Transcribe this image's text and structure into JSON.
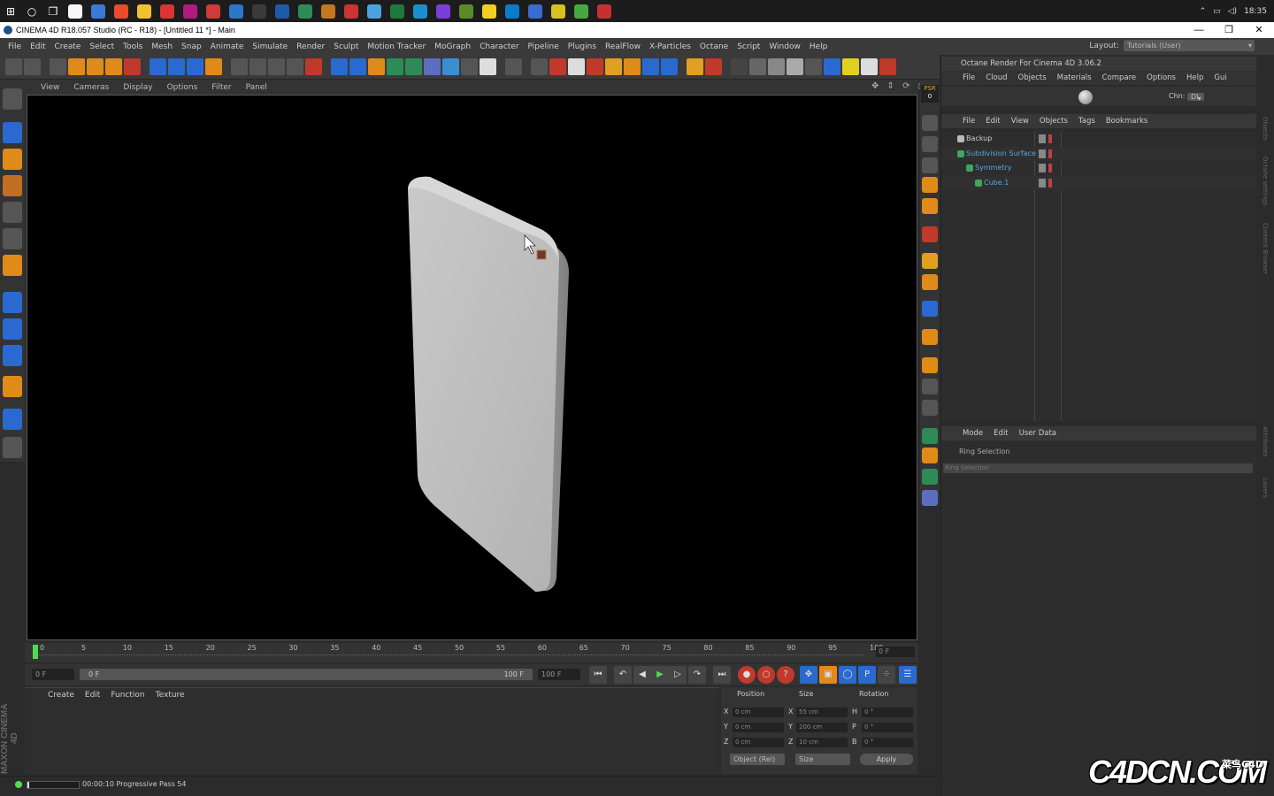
{
  "taskbar": {
    "time": "18:35",
    "app_colors": [
      "#f8f8f8",
      "#3a7bd5",
      "#e94b2b",
      "#f2c12e",
      "#d33",
      "#b01c7e",
      "#d03a3a",
      "#2b77c8",
      "#3a3a3a",
      "#1e5aa8",
      "#2e8b57",
      "#c2781f",
      "#cc3333",
      "#4aa3df",
      "#1e7a3c",
      "#1a8fd0",
      "#7a3ed8",
      "#5c8a2b",
      "#f0d020",
      "#0a7cc9",
      "#3a6bd0",
      "#d8c020",
      "#46a840",
      "#c83030"
    ]
  },
  "titlebar": {
    "title": "CINEMA 4D R18.057 Studio (RC - R18) - [Untitled 11 *] - Main",
    "minimize": "—",
    "maximize": "❐",
    "close": "✕"
  },
  "menubar": {
    "items": [
      "File",
      "Edit",
      "Create",
      "Select",
      "Tools",
      "Mesh",
      "Snap",
      "Animate",
      "Simulate",
      "Render",
      "Sculpt",
      "Motion Tracker",
      "MoGraph",
      "Character",
      "Pipeline",
      "Plugins",
      "RealFlow",
      "X-Particles",
      "Octane",
      "Script",
      "Window",
      "Help"
    ],
    "layout_label": "Layout:",
    "layout_value": "Tutorials (User)"
  },
  "viewport": {
    "menu": [
      "View",
      "Cameras",
      "Display",
      "Options",
      "Filter",
      "Panel"
    ],
    "nav_icons": "✥ ⇕ ⟳ ▢"
  },
  "timeline": {
    "ticks": [
      "0",
      "5",
      "10",
      "15",
      "20",
      "25",
      "30",
      "35",
      "40",
      "45",
      "50",
      "55",
      "60",
      "65",
      "70",
      "75",
      "80",
      "85",
      "90",
      "95",
      "100"
    ],
    "current_frame": "0 F"
  },
  "transport": {
    "start_frame": "0 F",
    "range_start": "0 F",
    "range_end": "100 F",
    "end_frame": "100 F"
  },
  "material_manager": {
    "menu": [
      "Create",
      "Edit",
      "Function",
      "Texture"
    ]
  },
  "maxon_logo": "MAXON CINEMA 4D",
  "coordinates": {
    "headers": [
      "Position",
      "Size",
      "Rotation"
    ],
    "rows": [
      {
        "axis": "X",
        "pos": "0 cm",
        "size_axis": "X",
        "size": "55 cm",
        "rot_axis": "H",
        "rot": "0 °"
      },
      {
        "axis": "Y",
        "pos": "0 cm",
        "size_axis": "Y",
        "size": "200 cm",
        "rot_axis": "P",
        "rot": "0 °"
      },
      {
        "axis": "Z",
        "pos": "0 cm",
        "size_axis": "Z",
        "size": "10 cm",
        "rot_axis": "B",
        "rot": "0 °"
      }
    ],
    "mode": "Object (Rel)",
    "size_mode": "Size",
    "apply": "Apply"
  },
  "statusbar": {
    "progress": 0.04,
    "text": "00:00:10 Progressive Pass 54"
  },
  "octane": {
    "title": "Octane Render For Cinema 4D 3.06.2",
    "menu": [
      "File",
      "Cloud",
      "Objects",
      "Materials",
      "Compare",
      "Options",
      "Help",
      "Gui"
    ],
    "chn_label": "Chn:",
    "chn_value": "DL",
    "psr_label": "PSR",
    "psr_value": "0"
  },
  "object_manager": {
    "menu": [
      "File",
      "Edit",
      "View",
      "Objects",
      "Tags",
      "Bookmarks"
    ],
    "objects": [
      {
        "name": "Backup",
        "color": "#cfcfcf",
        "indent": 0
      },
      {
        "name": "Subdivision Surface",
        "color": "#5aa6e0",
        "indent": 0
      },
      {
        "name": "Symmetry",
        "color": "#5aa6e0",
        "indent": 1
      },
      {
        "name": "Cube.1",
        "color": "#5aa6e0",
        "indent": 2
      }
    ]
  },
  "attributes": {
    "menu": [
      "Mode",
      "Edit",
      "User Data"
    ],
    "title": "Ring Selection",
    "section": "Ring Selection"
  },
  "side_tabs": [
    "Objects",
    "Octane settings",
    "Content Browser",
    "Attributes",
    "Layers"
  ],
  "watermark": {
    "main": "C4DCN.COM",
    "sub": "菜鸟C4D"
  }
}
